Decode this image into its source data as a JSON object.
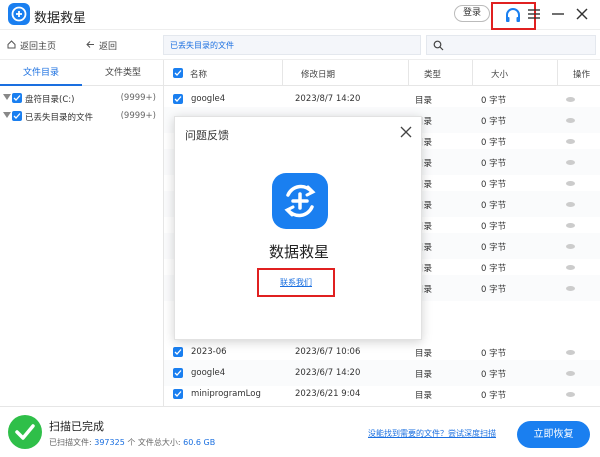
{
  "window": {
    "title": "数据救星",
    "login_label": "登录"
  },
  "toolbar": {
    "home_label": "返回主页",
    "back_label": "返回",
    "path_text": "已丢失目录的文件",
    "search_placeholder": ""
  },
  "sidebar": {
    "tabs": [
      {
        "label": "文件目录",
        "active": true
      },
      {
        "label": "文件类型",
        "active": false
      }
    ],
    "tree": [
      {
        "label": "盘符目录(C:)",
        "count": "(9999+)"
      },
      {
        "label": "已丢失目录的文件",
        "count": "(9999+)"
      }
    ]
  },
  "table": {
    "columns": {
      "name": "名称",
      "modified": "修改日期",
      "type": "类型",
      "size": "大小",
      "action": "操作"
    },
    "rows": [
      {
        "name": "google4",
        "date": "2023/8/7 14:20",
        "type": "目录",
        "size": "0 字节"
      },
      {
        "name": "",
        "date": "",
        "type": "目录",
        "size": "0 字节"
      },
      {
        "name": "",
        "date": "",
        "type": "目录",
        "size": "0 字节"
      },
      {
        "name": "",
        "date": "",
        "type": "目录",
        "size": "0 字节"
      },
      {
        "name": "",
        "date": "",
        "type": "目录",
        "size": "0 字节"
      },
      {
        "name": "",
        "date": "",
        "type": "目录",
        "size": "0 字节"
      },
      {
        "name": "",
        "date": "",
        "type": "目录",
        "size": "0 字节"
      },
      {
        "name": "",
        "date": "",
        "type": "目录",
        "size": "0 字节"
      },
      {
        "name": "",
        "date": "",
        "type": "目录",
        "size": "0 字节"
      },
      {
        "name": "",
        "date": "",
        "type": "目录",
        "size": "0 字节"
      },
      {
        "name": "2023-06",
        "date": "2023/6/7 10:06",
        "type": "目录",
        "size": "0 字节"
      },
      {
        "name": "google4",
        "date": "2023/6/7 14:20",
        "type": "目录",
        "size": "0 字节"
      },
      {
        "name": "miniprogramLog",
        "date": "2023/6/21 9:04",
        "type": "目录",
        "size": "0 字节"
      }
    ]
  },
  "dialog": {
    "title": "问题反馈",
    "app_name": "数据救星",
    "contact_link": "联系我们"
  },
  "footer": {
    "status": "扫描已完成",
    "scanned_label": "已扫描文件:",
    "scanned_count": "397325",
    "size_label": "个 文件总大小:",
    "size_value": "60.6 GB",
    "deep_scan_link": "没能找到需要的文件？尝试深度扫描",
    "recover_label": "立即恢复"
  },
  "colors": {
    "accent": "#1a7ff0",
    "success": "#2fbf49",
    "highlight_box": "#e02020"
  }
}
